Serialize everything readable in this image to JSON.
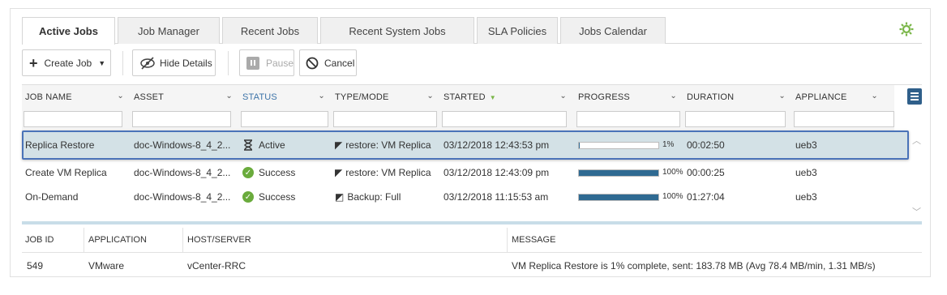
{
  "tabs": [
    {
      "label": "Active Jobs",
      "active": true
    },
    {
      "label": "Job Manager",
      "active": false
    },
    {
      "label": "Recent Jobs",
      "active": false
    },
    {
      "label": "Recent System Jobs",
      "active": false
    },
    {
      "label": "SLA Policies",
      "active": false
    },
    {
      "label": "Jobs Calendar",
      "active": false
    }
  ],
  "toolbar": {
    "create_job": "Create Job",
    "hide_details": "Hide Details",
    "pause": "Pause",
    "cancel": "Cancel"
  },
  "columns": [
    "JOB NAME",
    "ASSET",
    "STATUS",
    "TYPE/MODE",
    "STARTED",
    "PROGRESS",
    "DURATION",
    "APPLIANCE"
  ],
  "rows": [
    {
      "job_name": "Replica Restore",
      "asset": "doc-Windows-8_4_2...",
      "status": "Active",
      "status_icon": "hourglass-icon",
      "type_mode": "restore: VM Replica",
      "type_icon": "restore-icon",
      "started": "03/12/2018 12:43:53 pm",
      "progress": 1,
      "progress_label": "1%",
      "duration": "00:02:50",
      "appliance": "ueb3"
    },
    {
      "job_name": "Create VM Replica",
      "asset": "doc-Windows-8_4_2...",
      "status": "Success",
      "status_icon": "check-circle-icon",
      "type_mode": "restore: VM Replica",
      "type_icon": "restore-icon",
      "started": "03/12/2018 12:43:09 pm",
      "progress": 100,
      "progress_label": "100%",
      "duration": "00:00:25",
      "appliance": "ueb3"
    },
    {
      "job_name": "On-Demand",
      "asset": "doc-Windows-8_4_2...",
      "status": "Success",
      "status_icon": "check-circle-icon",
      "type_mode": "Backup: Full",
      "type_icon": "backup-icon",
      "started": "03/12/2018 11:15:53 am",
      "progress": 100,
      "progress_label": "100%",
      "duration": "01:27:04",
      "appliance": "ueb3"
    }
  ],
  "details": {
    "headers": [
      "JOB ID",
      "APPLICATION",
      "HOST/SERVER",
      "MESSAGE"
    ],
    "values": [
      "549",
      "VMware",
      "vCenter-RRC",
      "VM Replica Restore is 1% complete, sent: 183.78 MB (Avg 78.4 MB/min, 1.31 MB/s)"
    ]
  },
  "colors": {
    "accent": "#2f6a92",
    "status_link": "#3c73a8",
    "success": "#6aab3c",
    "gear": "#7ab648",
    "selection_border": "#4a73b8",
    "selection_bg": "#d3e1e6"
  }
}
